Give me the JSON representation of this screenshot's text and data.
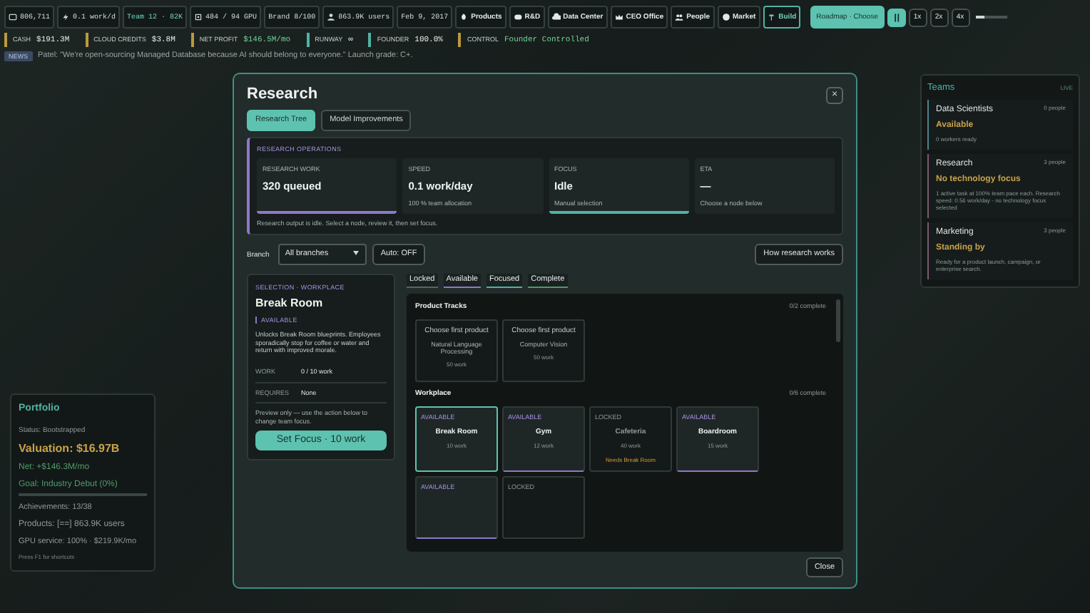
{
  "top_bar": {
    "stats": [
      {
        "kind": "money",
        "text": "806,711"
      },
      {
        "kind": "speed",
        "text": "0.1 work/d"
      },
      {
        "kind": "team",
        "text": "Team 12 · 82K"
      },
      {
        "kind": "gpu",
        "text": "484 / 94 GPU"
      },
      {
        "kind": "plain",
        "text": "Brand 8/100"
      },
      {
        "kind": "users",
        "text": "863.9K users"
      },
      {
        "kind": "plain",
        "text": "Feb 9, 2017"
      }
    ],
    "nav": [
      {
        "label": "Products",
        "selected": false
      },
      {
        "label": "R&D",
        "selected": false
      },
      {
        "label": "Data Center",
        "selected": false
      },
      {
        "label": "CEO Office",
        "selected": false
      },
      {
        "label": "People",
        "selected": false
      },
      {
        "label": "Market",
        "selected": false
      },
      {
        "label": "Build",
        "selected": true
      }
    ],
    "roadmap_button": "Roadmap · Choose",
    "paused": true,
    "speeds": [
      {
        "label": "1x",
        "selected": false
      },
      {
        "label": "2x",
        "selected": false
      },
      {
        "label": "4x",
        "selected": false
      }
    ],
    "speed_slider": {
      "level": 0.3
    }
  },
  "metrics": [
    {
      "label": "CASH",
      "value": "$191.3M",
      "kind": "plain"
    },
    {
      "label": "CLOUD CREDITS",
      "value": "$3.8M",
      "kind": "plain"
    },
    {
      "label": "NET PROFIT",
      "value": "$146.5M/mo",
      "kind": "good"
    },
    {
      "label": "RUNWAY",
      "value": "∞",
      "kind": "plain"
    },
    {
      "label": "FOUNDER",
      "value": "100.0%",
      "kind": "plain"
    },
    {
      "label": "CONTROL",
      "value": "Founder Controlled",
      "kind": "good"
    }
  ],
  "news": {
    "badge": "NEWS",
    "text": "Patel: \"We're open-sourcing Managed Database because AI should belong to everyone.\" Launch grade: C+."
  },
  "portfolio": {
    "title": "Portfolio",
    "status": "Status: Bootstrapped",
    "valuation": "Valuation: $16.97B",
    "net": "Net: +$146.3M/mo",
    "goal": "Goal: Industry Debut (0%)",
    "goal_progress": {
      "level": 0
    },
    "achievements": "Achievements: 13/38",
    "products": "Products: [==] 863.9K users",
    "gpu": "GPU service: 100% · $219.9K/mo",
    "hint": "Press F1 for shortcuts"
  },
  "teams": {
    "title": "Teams",
    "live_label": "LIVE",
    "items": [
      {
        "name": "Data Scientists",
        "count": "0 people",
        "status": "Available",
        "detail": "0 workers ready",
        "color": "#4f7f8c"
      },
      {
        "name": "Research",
        "count": "3 people",
        "status": "No technology focus",
        "detail": "1 active task at 100% team pace each. Research speed: 0.56 work/day - no technology focus selected",
        "color": "#7a5a6e"
      },
      {
        "name": "Marketing",
        "count": "3 people",
        "status": "Standing by",
        "detail": "Ready for a product launch, campaign, or enterprise search.",
        "color": "#7a5a6e"
      }
    ]
  },
  "modal": {
    "title": "Research",
    "close": "×",
    "tabs": [
      {
        "label": "Research Tree",
        "selected": true
      },
      {
        "label": "Model Improvements",
        "selected": false
      }
    ],
    "operations": {
      "title": "RESEARCH OPERATIONS",
      "cards": [
        {
          "label": "RESEARCH WORK",
          "value": "320 queued",
          "color": "#8f78c9"
        },
        {
          "label": "SPEED",
          "value": "0.1 work/day",
          "note": "100 % team allocation"
        },
        {
          "label": "FOCUS",
          "value": "Idle",
          "note": "Manual selection",
          "color": "#4fb3a3"
        },
        {
          "label": "ETA",
          "value": "—",
          "note": "Choose a node below"
        }
      ],
      "note": "Research output is idle. Select a node, review it, then set focus."
    },
    "branch_label": "Branch",
    "branch_select": "All branches",
    "auto_button": "Auto: OFF",
    "help_button": "How research works",
    "selection": {
      "eyebrow": "SELECTION · WORKPLACE",
      "title": "Break Room",
      "status": "AVAILABLE",
      "description": "Unlocks Break Room blueprints. Employees sporadically stop for coffee or water and return with improved morale.",
      "rows": [
        {
          "label": "WORK",
          "value": "0 / 10 work"
        },
        {
          "label": "REQUIRES",
          "value": "None"
        }
      ],
      "note": "Preview only — use the action below to change team focus.",
      "button": "Set Focus · 10 work"
    },
    "legend": [
      {
        "label": "Locked",
        "color": "#5a6466"
      },
      {
        "label": "Available",
        "color": "#8f78c9"
      },
      {
        "label": "Focused",
        "color": "#4fb3a3"
      },
      {
        "label": "Complete",
        "color": "#4f9a6a"
      }
    ],
    "sections": [
      {
        "title": "Product Tracks",
        "completed_text": "0/2 complete",
        "nodes": [
          {
            "kind": "track",
            "title": "Choose first product",
            "subtitle": "Natural Language Processing",
            "work": "50 work",
            "selected": false
          },
          {
            "kind": "track",
            "title": "Choose first product",
            "subtitle": "Computer Vision",
            "work": "50 work",
            "selected": false
          }
        ]
      },
      {
        "title": "Workplace",
        "completed_text": "0/6 complete",
        "nodes": [
          {
            "kind": "available",
            "status": "AVAILABLE",
            "title": "Break Room",
            "work": "10 work",
            "selected": true
          },
          {
            "kind": "available",
            "status": "AVAILABLE",
            "title": "Gym",
            "work": "12 work",
            "selected": false
          },
          {
            "kind": "locked",
            "status": "LOCKED",
            "title": "Cafeteria",
            "work": "40 work",
            "needs": "Needs Break Room",
            "selected": false
          },
          {
            "kind": "available",
            "status": "AVAILABLE",
            "title": "Boardroom",
            "work": "15 work",
            "selected": false
          },
          {
            "kind": "available",
            "status": "AVAILABLE",
            "selected": false
          },
          {
            "kind": "locked",
            "status": "LOCKED",
            "selected": false
          }
        ]
      }
    ],
    "close_button": "Close"
  }
}
